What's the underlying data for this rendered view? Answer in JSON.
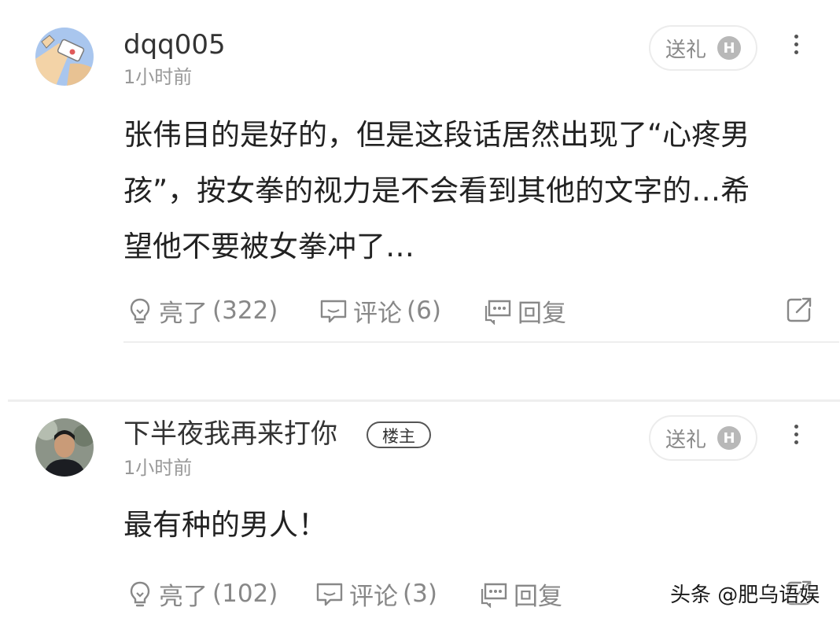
{
  "comments": [
    {
      "username": "dqq005",
      "time": "1小时前",
      "gift_label": "送礼",
      "coin_label": "H",
      "text_lines": [
        "张伟目的是好的，但是这段话居然出现了“心疼男",
        "孩”，按女拳的视力是不会看到其他的文字的…希",
        "望他不要被女拳冲了…"
      ],
      "like_label": "亮了",
      "like_count": "(322)",
      "comment_label": "评论",
      "comment_count": "(6)",
      "reply_label": "回复"
    },
    {
      "username": "下半夜我再来打你",
      "badge": "楼主",
      "time": "1小时前",
      "gift_label": "送礼",
      "coin_label": "H",
      "text_lines": [
        "最有种的男人！"
      ],
      "like_label": "亮了",
      "like_count": "(102)",
      "comment_label": "评论",
      "comment_count": "(3)",
      "reply_label": "回复"
    }
  ],
  "watermark": "头条 @肥乌语娱",
  "icons": {
    "like": "lightbulb-icon",
    "comment": "comment-bubble-icon",
    "reply": "reply-bubble-icon",
    "share": "share-icon",
    "more": "more-vertical-icon"
  },
  "colors": {
    "text": "#222222",
    "muted": "#888888",
    "divider": "#eeeeee"
  }
}
